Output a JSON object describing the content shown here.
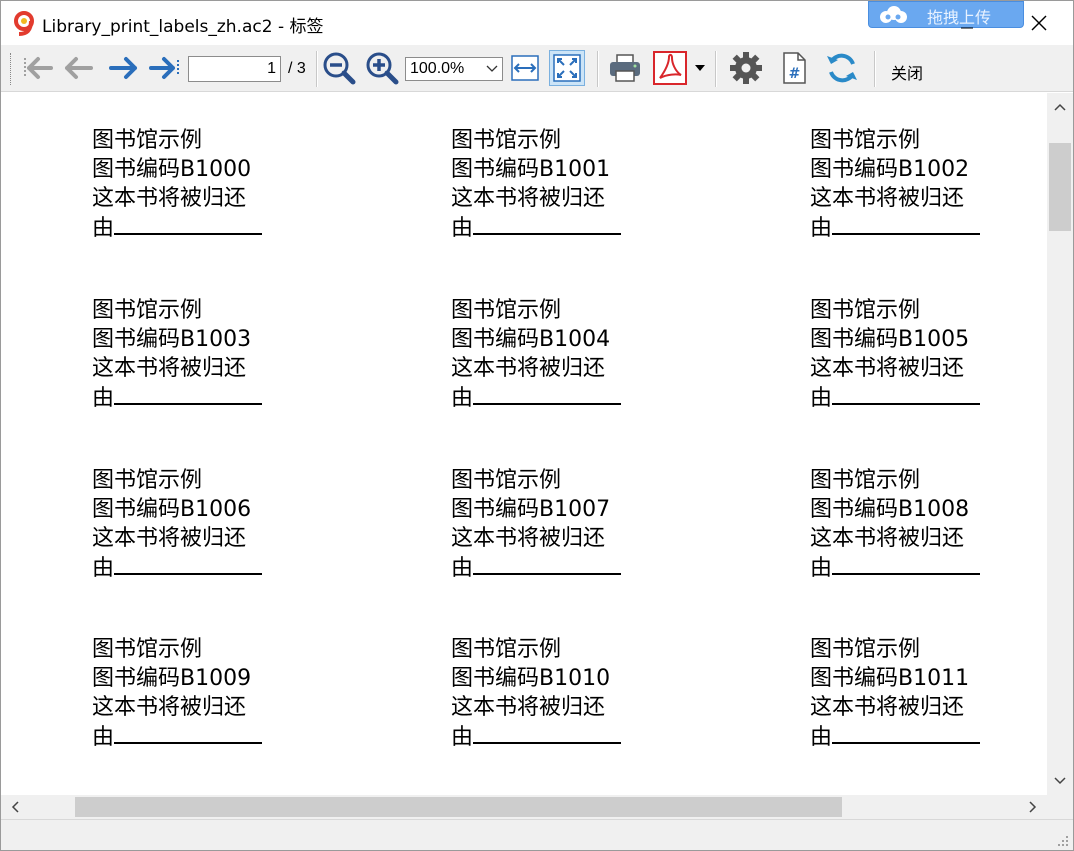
{
  "window": {
    "title": "Library_print_labels_zh.ac2 - 标签",
    "upload_label": "拖拽上传"
  },
  "toolbar": {
    "page_current": "1",
    "page_total": "/ 3",
    "zoom_value": "100.0%",
    "close_label": "关闭"
  },
  "labels": [
    {
      "l1": "图书馆示例",
      "l2": "图书编码B1000",
      "l3": "这本书将被归还",
      "l4": "由"
    },
    {
      "l1": "图书馆示例",
      "l2": "图书编码B1001",
      "l3": "这本书将被归还",
      "l4": "由"
    },
    {
      "l1": "图书馆示例",
      "l2": "图书编码B1002",
      "l3": "这本书将被归还",
      "l4": "由"
    },
    {
      "l1": "图书馆示例",
      "l2": "图书编码B1003",
      "l3": "这本书将被归还",
      "l4": "由"
    },
    {
      "l1": "图书馆示例",
      "l2": "图书编码B1004",
      "l3": "这本书将被归还",
      "l4": "由"
    },
    {
      "l1": "图书馆示例",
      "l2": "图书编码B1005",
      "l3": "这本书将被归还",
      "l4": "由"
    },
    {
      "l1": "图书馆示例",
      "l2": "图书编码B1006",
      "l3": "这本书将被归还",
      "l4": "由"
    },
    {
      "l1": "图书馆示例",
      "l2": "图书编码B1007",
      "l3": "这本书将被归还",
      "l4": "由"
    },
    {
      "l1": "图书馆示例",
      "l2": "图书编码B1008",
      "l3": "这本书将被归还",
      "l4": "由"
    },
    {
      "l1": "图书馆示例",
      "l2": "图书编码B1009",
      "l3": "这本书将被归还",
      "l4": "由"
    },
    {
      "l1": "图书馆示例",
      "l2": "图书编码B1010",
      "l3": "这本书将被归还",
      "l4": "由"
    },
    {
      "l1": "图书馆示例",
      "l2": "图书编码B1011",
      "l3": "这本书将被归还",
      "l4": "由"
    }
  ],
  "icons": {
    "first_page": "first-page-icon",
    "prev_page": "prev-page-icon",
    "next_page": "next-page-icon",
    "last_page": "last-page-icon",
    "zoom_out": "zoom-out-icon",
    "zoom_in": "zoom-in-icon",
    "fit_width": "fit-width-icon",
    "fit_page": "fit-page-icon",
    "print": "print-icon",
    "pdf": "pdf-icon",
    "settings": "gear-icon",
    "page_number": "page-number-icon",
    "refresh": "refresh-icon"
  },
  "colors": {
    "accent_blue": "#2a6ebb",
    "pdf_red": "#d9262b",
    "disabled_gray": "#a0a0a0"
  }
}
